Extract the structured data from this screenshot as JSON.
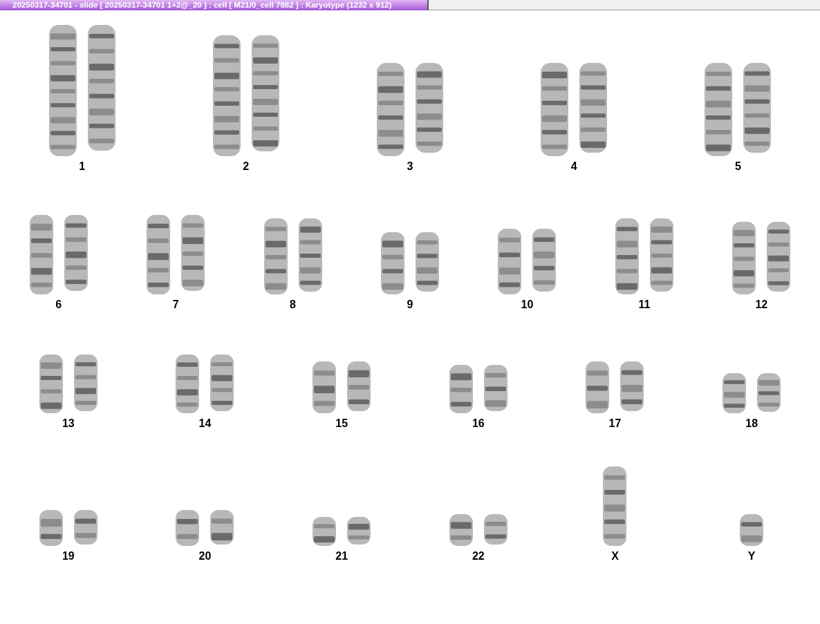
{
  "window": {
    "title": "20250317-34701 - slide [ 20250317-34701 1+2@_20 ] : cell [ M21/0_cell 7882 ] : Karyotype  (1232 x 912)"
  },
  "karyotype": {
    "rows": [
      {
        "groups": [
          {
            "label": "1",
            "kind": "pair"
          },
          {
            "label": "2",
            "kind": "pair"
          },
          {
            "label": "3",
            "kind": "pair"
          },
          {
            "label": "4",
            "kind": "pair"
          },
          {
            "label": "5",
            "kind": "pair"
          }
        ]
      },
      {
        "groups": [
          {
            "label": "6",
            "kind": "pair"
          },
          {
            "label": "7",
            "kind": "pair"
          },
          {
            "label": "8",
            "kind": "pair"
          },
          {
            "label": "9",
            "kind": "pair"
          },
          {
            "label": "10",
            "kind": "pair"
          },
          {
            "label": "11",
            "kind": "pair"
          },
          {
            "label": "12",
            "kind": "pair"
          }
        ]
      },
      {
        "groups": [
          {
            "label": "13",
            "kind": "pair"
          },
          {
            "label": "14",
            "kind": "pair"
          },
          {
            "label": "15",
            "kind": "pair"
          },
          {
            "label": "16",
            "kind": "pair"
          },
          {
            "label": "17",
            "kind": "pair"
          },
          {
            "label": "18",
            "kind": "pair"
          }
        ]
      },
      {
        "groups": [
          {
            "label": "19",
            "kind": "pair"
          },
          {
            "label": "20",
            "kind": "pair"
          },
          {
            "label": "21",
            "kind": "pair"
          },
          {
            "label": "22",
            "kind": "pair"
          },
          {
            "label": "X",
            "kind": "single"
          },
          {
            "label": "Y",
            "kind": "single"
          }
        ]
      }
    ]
  }
}
